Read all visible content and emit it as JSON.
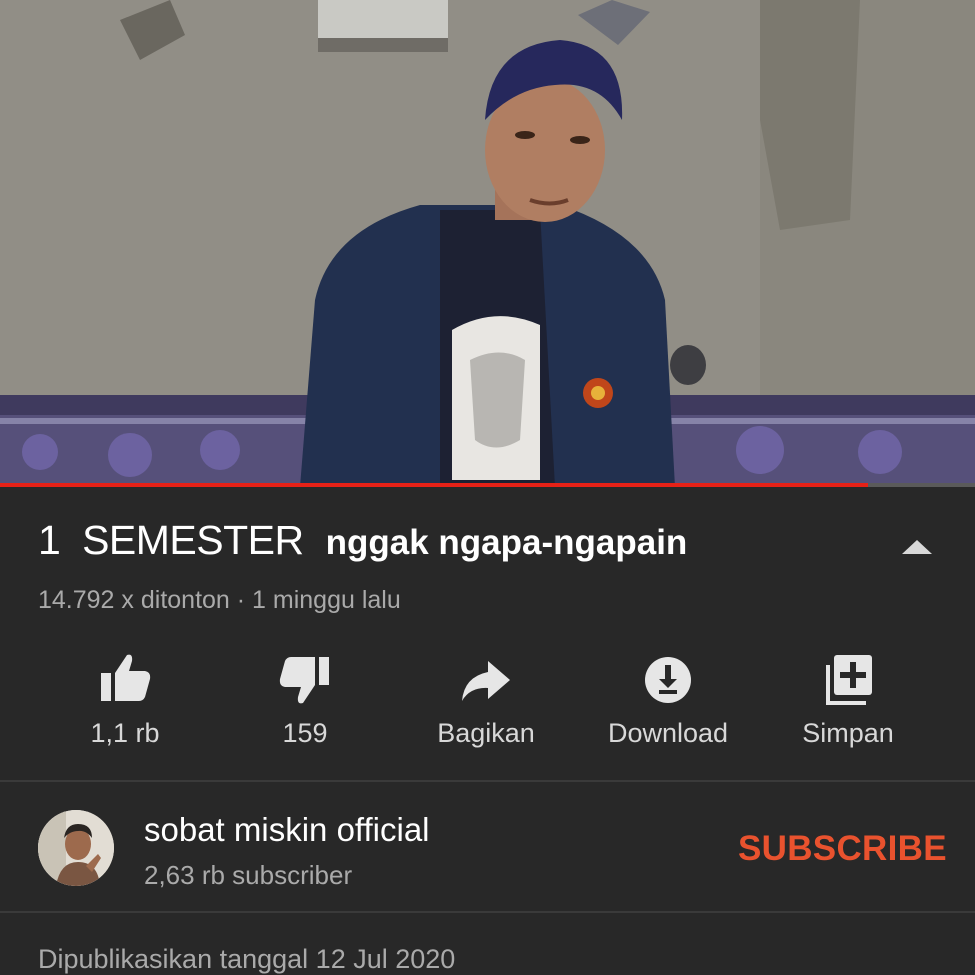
{
  "video": {
    "progress": 0.89
  },
  "title": {
    "main": "1  SEMESTER",
    "sub": "nggak ngapa-ngapain"
  },
  "meta": {
    "views_and_age": "14.792 x ditonton · 1 minggu lalu"
  },
  "actions": [
    {
      "icon": "thumbs-up-icon",
      "label": "1,1 rb"
    },
    {
      "icon": "thumbs-down-icon",
      "label": "159"
    },
    {
      "icon": "share-icon",
      "label": "Bagikan"
    },
    {
      "icon": "download-icon",
      "label": "Download"
    },
    {
      "icon": "add-to-playlist-icon",
      "label": "Simpan"
    }
  ],
  "channel": {
    "name": "sobat miskin official",
    "subscribers": "2,63 rb subscriber",
    "subscribe_label": "SUBSCRIBE"
  },
  "description": {
    "published": "Dipublikasikan tanggal 12 Jul 2020"
  },
  "colors": {
    "background": "#282828",
    "progress": "#e62117",
    "subscribe": "#e9522e",
    "secondary_text": "#aaaaaa"
  }
}
